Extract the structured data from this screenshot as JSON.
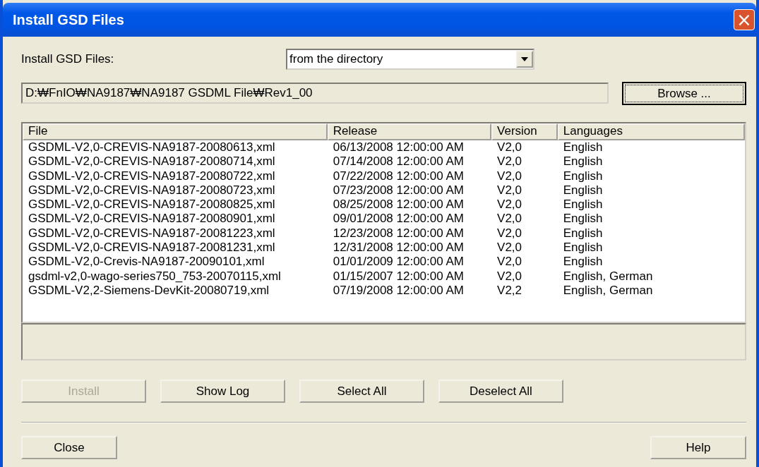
{
  "window": {
    "title": "Install GSD Files",
    "close": "×"
  },
  "source": {
    "label": "Install GSD Files:",
    "value": "from the directory"
  },
  "path": {
    "value": "D:₩FnIO₩NA9187₩NA9187 GSDML File₩Rev1_00"
  },
  "browse": {
    "label": "Browse ...",
    "focused": true
  },
  "table": {
    "columns": [
      "File",
      "Release",
      "Version",
      "Languages"
    ],
    "rows": [
      [
        "GSDML-V2,0-CREVIS-NA9187-20080613,xml",
        "06/13/2008 12:00:00 AM",
        "V2,0",
        "English"
      ],
      [
        "GSDML-V2,0-CREVIS-NA9187-20080714,xml",
        "07/14/2008 12:00:00 AM",
        "V2,0",
        "English"
      ],
      [
        "GSDML-V2,0-CREVIS-NA9187-20080722,xml",
        "07/22/2008 12:00:00 AM",
        "V2,0",
        "English"
      ],
      [
        "GSDML-V2,0-CREVIS-NA9187-20080723,xml",
        "07/23/2008 12:00:00 AM",
        "V2,0",
        "English"
      ],
      [
        "GSDML-V2,0-CREVIS-NA9187-20080825,xml",
        "08/25/2008 12:00:00 AM",
        "V2,0",
        "English"
      ],
      [
        "GSDML-V2,0-CREVIS-NA9187-20080901,xml",
        "09/01/2008 12:00:00 AM",
        "V2,0",
        "English"
      ],
      [
        "GSDML-V2,0-CREVIS-NA9187-20081223,xml",
        "12/23/2008 12:00:00 AM",
        "V2,0",
        "English"
      ],
      [
        "GSDML-V2,0-CREVIS-NA9187-20081231,xml",
        "12/31/2008 12:00:00 AM",
        "V2,0",
        "English"
      ],
      [
        "GSDML-V2,0-Crevis-NA9187-20090101,xml",
        "01/01/2009 12:00:00 AM",
        "V2,0",
        "English"
      ],
      [
        "gsdml-v2,0-wago-series750_753-20070115,xml",
        "01/15/2007 12:00:00 AM",
        "V2,0",
        "English, German"
      ],
      [
        "GSDML-V2,2-Siemens-DevKit-20080719,xml",
        "07/19/2008 12:00:00 AM",
        "V2,2",
        "English, German"
      ]
    ]
  },
  "actions": [
    {
      "label": "Install",
      "disabled": true
    },
    {
      "label": "Show Log",
      "disabled": false
    },
    {
      "label": "Select All",
      "disabled": false
    },
    {
      "label": "Deselect All",
      "disabled": false
    }
  ],
  "footer": [
    {
      "label": "Close"
    },
    {
      "label": "Help"
    }
  ]
}
